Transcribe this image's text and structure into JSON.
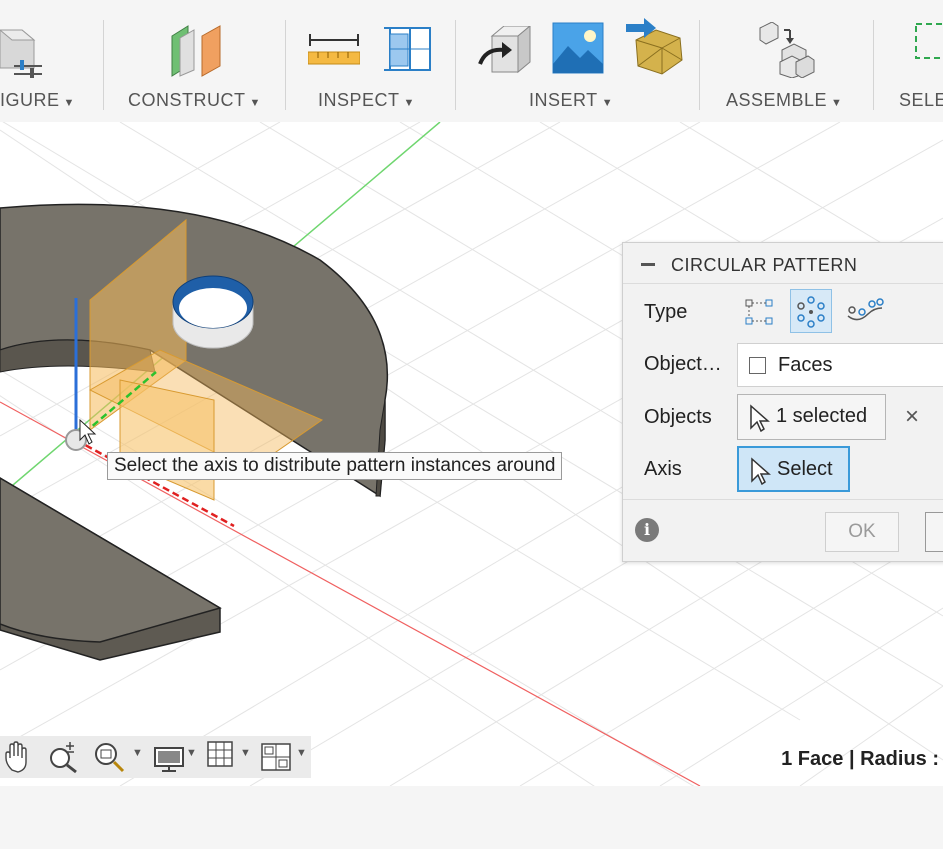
{
  "toolbar": {
    "groups": [
      {
        "label": "IGURE",
        "icon": "configure-icon"
      },
      {
        "label": "CONSTRUCT",
        "icon": "construct-plane-icon"
      },
      {
        "label": "INSPECT",
        "icon": "measure-icon"
      },
      {
        "label": "INSERT",
        "icon": "insert-icon"
      },
      {
        "label": "ASSEMBLE",
        "icon": "assemble-icon"
      },
      {
        "label": "SELE",
        "icon": "select-icon"
      }
    ]
  },
  "viewport": {
    "tooltip": "Select the axis to distribute pattern instances around"
  },
  "panel": {
    "title": "CIRCULAR PATTERN",
    "rows": {
      "type_label": "Type",
      "object_type_label": "Object…",
      "object_type_value": "Faces",
      "objects_label": "Objects",
      "objects_value": "1 selected",
      "objects_clear": "×",
      "axis_label": "Axis",
      "axis_value": "Select"
    },
    "type_options": [
      "rectangular-pattern-icon",
      "circular-pattern-icon",
      "path-pattern-icon"
    ],
    "selected_type": "circular-pattern-icon",
    "ok_label": "OK",
    "info_icon": "i"
  },
  "navbar": {
    "icons": [
      "pan-icon",
      "zoom-icon",
      "zoom-window-icon",
      "display-settings-icon",
      "grid-icon",
      "viewports-icon"
    ]
  },
  "status": {
    "text": "1 Face | Radius :"
  },
  "colors": {
    "accent": "#3a9ad9",
    "plane": "#f5b95a",
    "body": "#77736a"
  }
}
